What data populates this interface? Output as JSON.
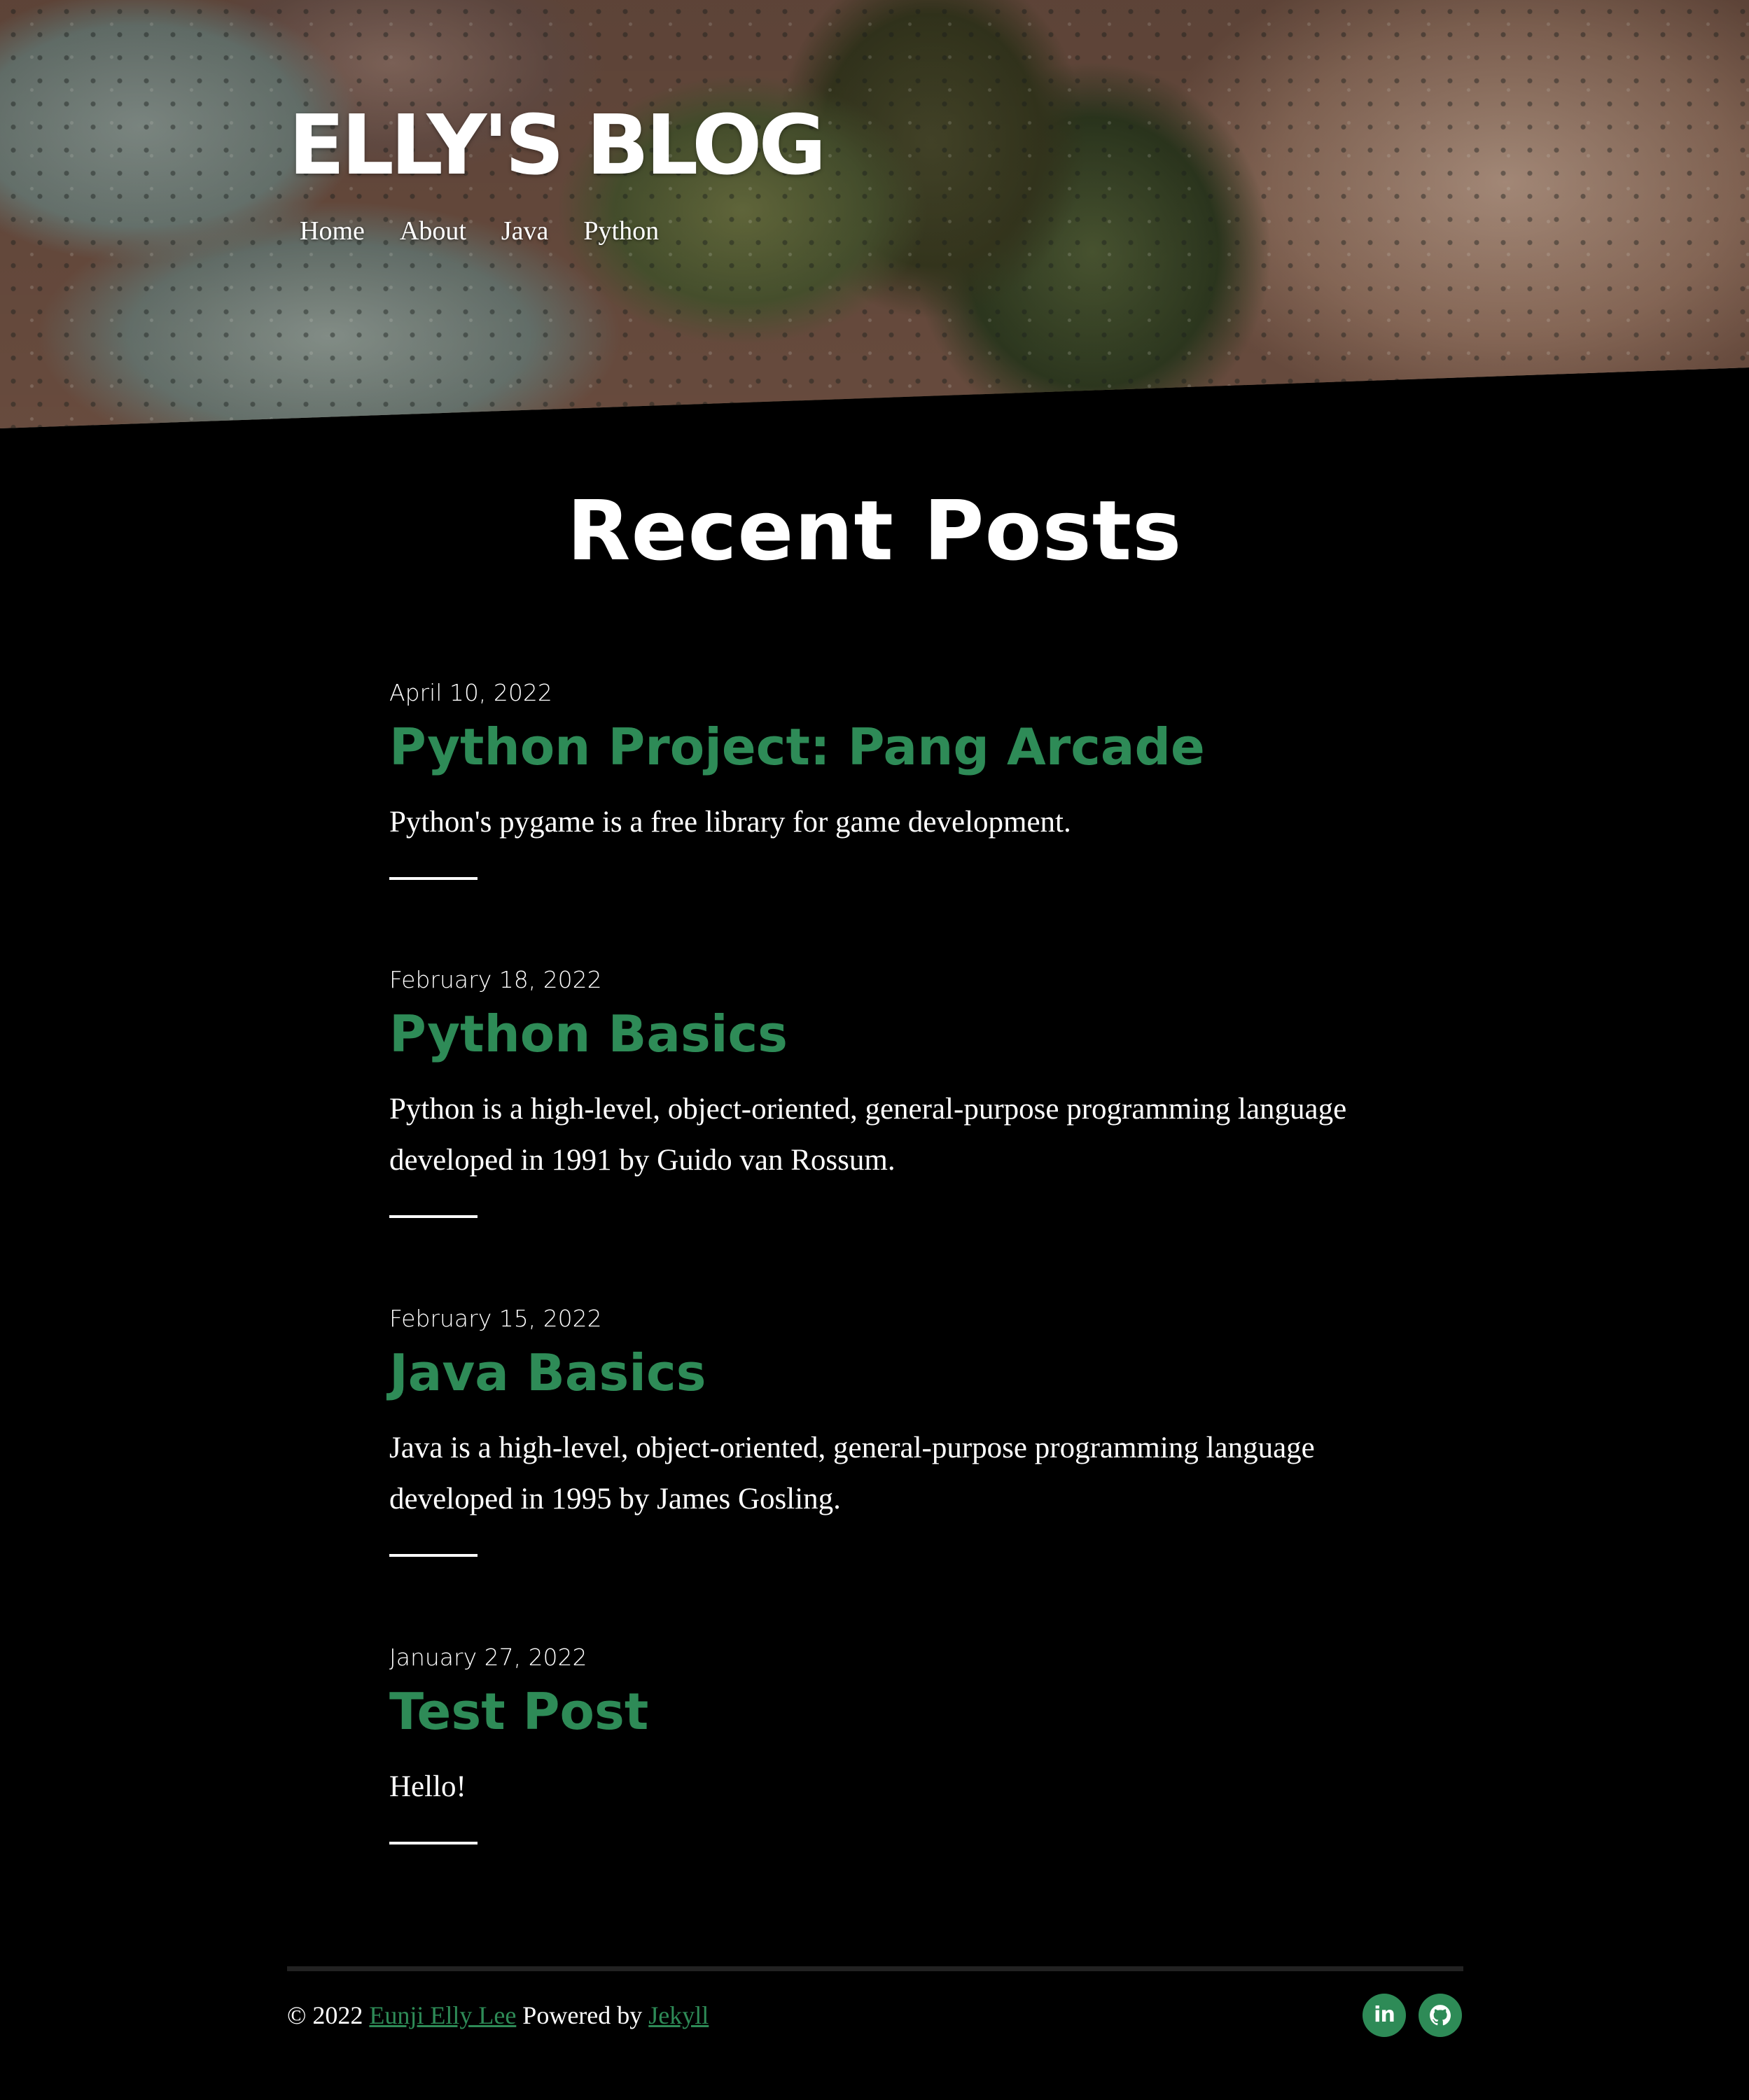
{
  "site": {
    "title": "ELLY'S BLOG",
    "nav": [
      {
        "label": "Home"
      },
      {
        "label": "About"
      },
      {
        "label": "Java"
      },
      {
        "label": "Python"
      }
    ]
  },
  "main": {
    "heading": "Recent Posts",
    "posts": [
      {
        "date": "April 10, 2022",
        "title": "Python Project: Pang Arcade",
        "excerpt": "Python's pygame is a free library for game development."
      },
      {
        "date": "February 18, 2022",
        "title": "Python Basics",
        "excerpt": "Python is a high-level, object-oriented, general-purpose programming language developed in 1991 by Guido van Rossum."
      },
      {
        "date": "February 15, 2022",
        "title": "Java Basics",
        "excerpt": "Java is a high-level, object-oriented, general-purpose programming language developed in 1995 by James Gosling."
      },
      {
        "date": "January 27, 2022",
        "title": "Test Post",
        "excerpt": "Hello!"
      }
    ]
  },
  "footer": {
    "copyright": "© 2022",
    "author_link": "Eunji Elly Lee",
    "powered_by": "Powered by",
    "jekyll_link": "Jekyll",
    "social": [
      {
        "icon": "linkedin-icon"
      },
      {
        "icon": "github-icon"
      }
    ]
  },
  "colors": {
    "background": "#000000",
    "accent": "#2e8b57",
    "text": "#ffffff"
  }
}
